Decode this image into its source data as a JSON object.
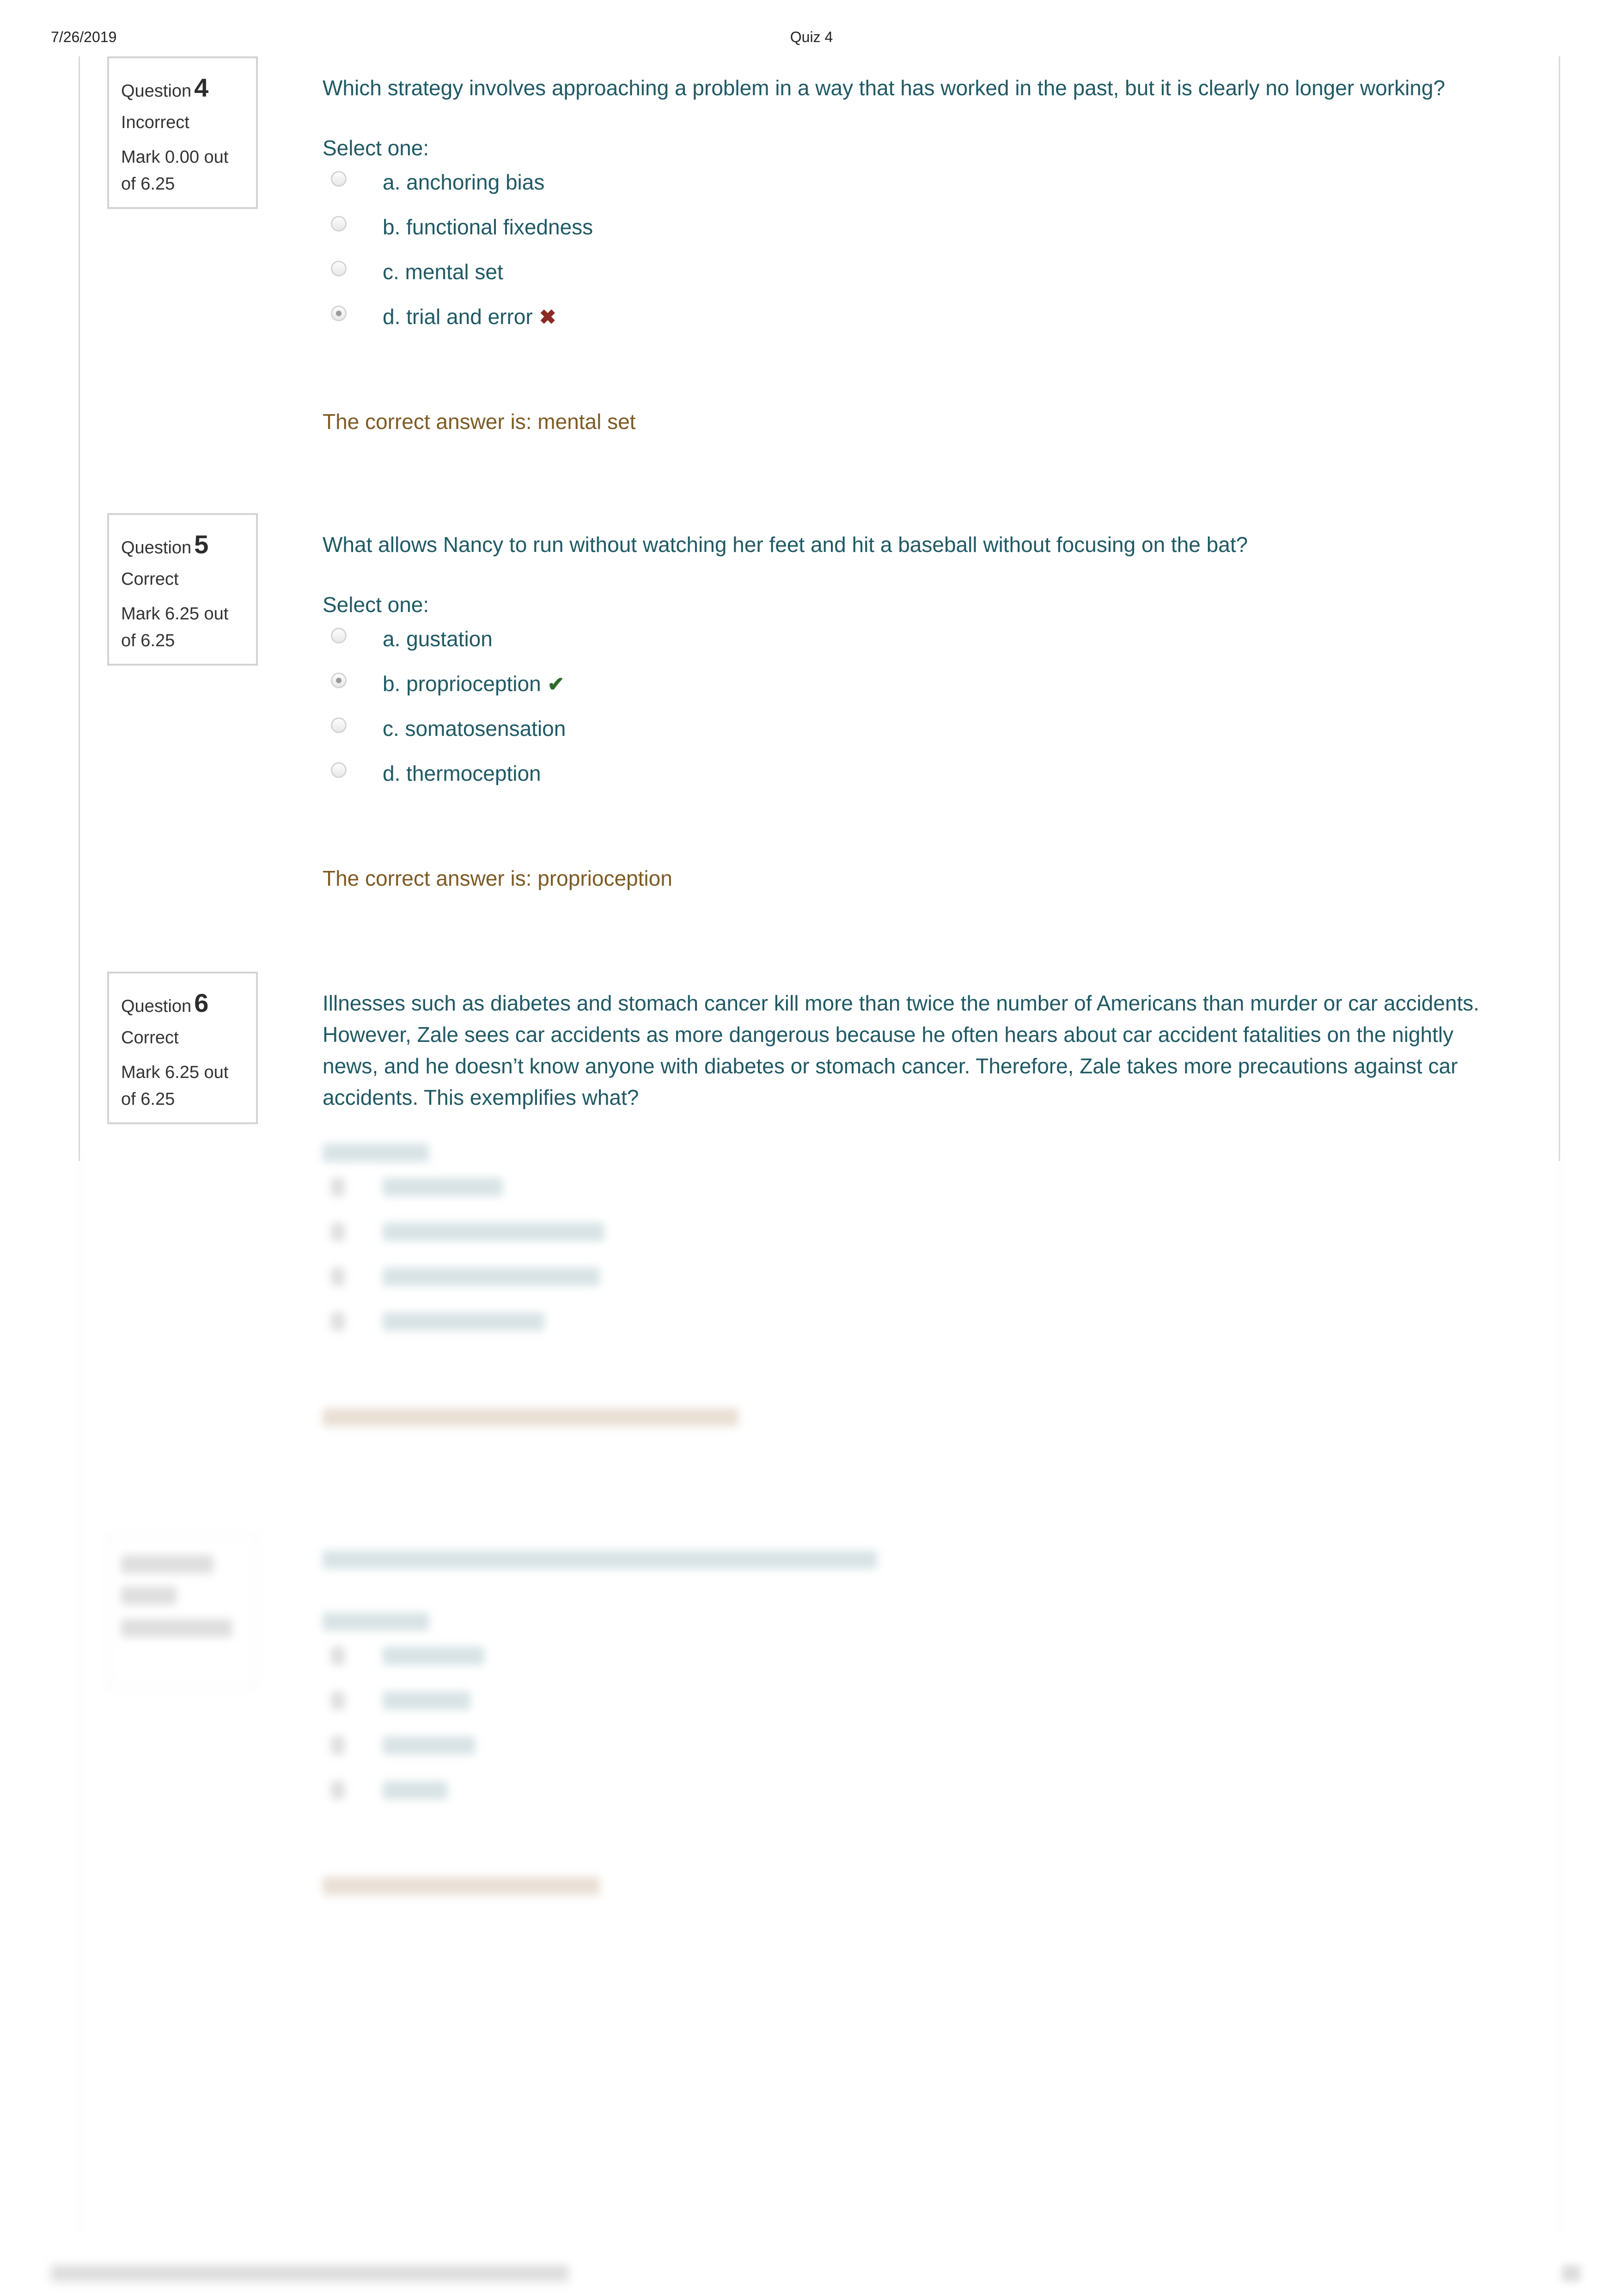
{
  "print_header": {
    "date": "7/26/2019",
    "title": "Quiz 4"
  },
  "colors": {
    "question_text": "#1f5964",
    "right_answer": "#7d5a24",
    "incorrect_icon": "#8b2a24",
    "correct_icon": "#2e6b2a",
    "info_border": "#d2d3d6"
  },
  "questions": [
    {
      "label": "Question",
      "number": "4",
      "state": "Incorrect",
      "grade": "Mark 0.00 out of 6.25",
      "text": "Which strategy involves approaching a problem in a way that has worked in the past, but it is clearly no longer working?",
      "prompt": "Select one:",
      "answers": [
        {
          "label": "a. anchoring bias",
          "selected": false,
          "feedback_icon": ""
        },
        {
          "label": "b. functional fixedness",
          "selected": false,
          "feedback_icon": ""
        },
        {
          "label": "c. mental set",
          "selected": false,
          "feedback_icon": ""
        },
        {
          "label": "d. trial and error",
          "selected": true,
          "feedback_icon": "incorrect-x-icon",
          "icon_glyph": "✖"
        }
      ],
      "right_answer": "The correct answer is: mental set"
    },
    {
      "label": "Question",
      "number": "5",
      "state": "Correct",
      "grade": "Mark 6.25 out of 6.25",
      "text": "What allows Nancy to run without watching her feet and hit a baseball without focusing on the bat?",
      "prompt": "Select one:",
      "answers": [
        {
          "label": "a. gustation",
          "selected": false,
          "feedback_icon": ""
        },
        {
          "label": "b. proprioception",
          "selected": true,
          "feedback_icon": "correct-check-icon",
          "icon_glyph": "✔"
        },
        {
          "label": "c. somatosensation",
          "selected": false,
          "feedback_icon": ""
        },
        {
          "label": "d. thermoception",
          "selected": false,
          "feedback_icon": ""
        }
      ],
      "right_answer": "The correct answer is: proprioception"
    },
    {
      "label": "Question",
      "number": "6",
      "state": "Correct",
      "grade": "Mark 6.25 out of 6.25",
      "text": "Illnesses such as diabetes and stomach cancer kill more than twice the number of Americans than murder or car accidents. However, Zale sees car accidents as more dangerous because he often hears about car accident fatalities on the nightly news, and he doesn’t know anyone with diabetes or stomach cancer. Therefore, Zale takes more precautions against car accidents. This exemplifies what?"
    }
  ]
}
